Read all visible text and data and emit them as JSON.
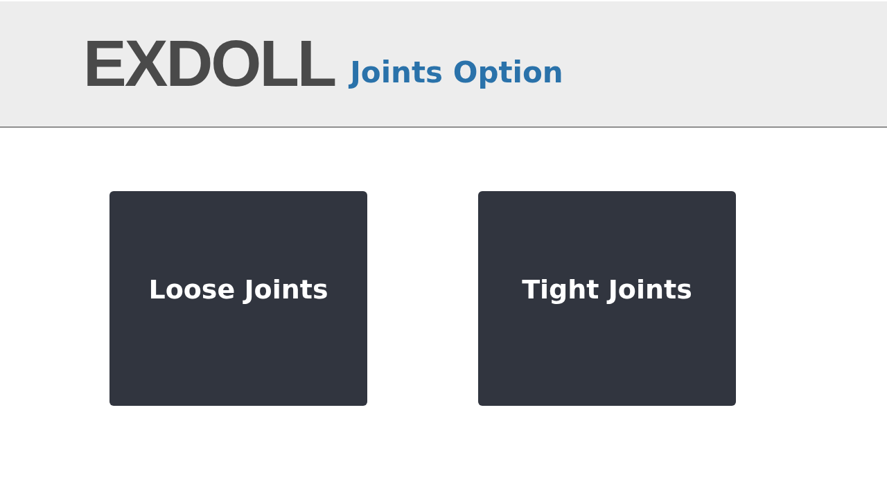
{
  "header": {
    "logo": "EXDOLL",
    "title": "Joints Option"
  },
  "options": [
    {
      "label": "Loose Joints"
    },
    {
      "label": "Tight Joints"
    }
  ]
}
